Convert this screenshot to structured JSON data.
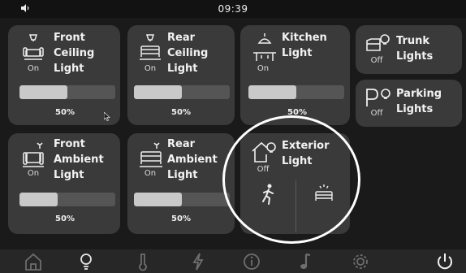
{
  "status": {
    "time": "09:39",
    "volume_icon": "speaker-icon"
  },
  "tiles": {
    "front_ceiling": {
      "lines": [
        "Front",
        "Ceiling",
        "Light"
      ],
      "state": "On",
      "level": 0.5,
      "percent": "50%"
    },
    "rear_ceiling": {
      "lines": [
        "Rear",
        "Ceiling",
        "Light"
      ],
      "state": "On",
      "level": 0.5,
      "percent": "50%"
    },
    "kitchen": {
      "lines": [
        "Kitchen",
        "Light"
      ],
      "state": "On",
      "level": 0.5,
      "percent": "50%"
    },
    "trunk": {
      "lines": [
        "Trunk",
        "Lights"
      ],
      "state": "Off"
    },
    "parking": {
      "lines": [
        "Parking",
        "Lights"
      ],
      "state": "Off"
    },
    "front_ambient": {
      "lines": [
        "Front",
        "Ambient",
        "Light"
      ],
      "state": "On",
      "level": 0.4,
      "percent": "50%"
    },
    "rear_ambient": {
      "lines": [
        "Rear",
        "Ambient",
        "Light"
      ],
      "state": "On",
      "level": 0.5,
      "percent": "50%"
    },
    "exterior": {
      "lines": [
        "Exterior",
        "Light"
      ],
      "state": "Off"
    }
  },
  "nav": [
    "home-icon",
    "bulb-icon",
    "thermometer-icon",
    "lightning-icon",
    "info-icon",
    "music-icon",
    "gear-icon",
    "power-icon"
  ],
  "colors": {
    "background": "#1a1a1a",
    "tile": "#3a3a3a",
    "bar_fill": "#c9c9c9",
    "bar_track": "#555555",
    "highlight_ring": "#ffffff"
  }
}
